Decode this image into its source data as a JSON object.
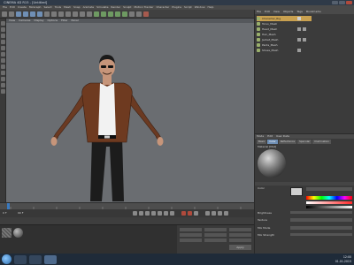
{
  "window": {
    "title": "CINEMA 4D R15 - [Untitled]"
  },
  "menubar": {
    "items": [
      "File",
      "Edit",
      "Create",
      "MoGraph",
      "Select",
      "Tools",
      "Mesh",
      "Snap",
      "Animate",
      "Simulate",
      "Render",
      "Sculpt",
      "Motion Tracker",
      "Character",
      "Plugins",
      "Script",
      "Window",
      "Help"
    ]
  },
  "viewport": {
    "menu": [
      "View",
      "Cameras",
      "Display",
      "Options",
      "Filter",
      "Panel"
    ]
  },
  "object_manager": {
    "tabs": [
      "File",
      "Edit",
      "View",
      "Objects",
      "Tags",
      "Bookmarks"
    ],
    "objects": [
      "Character_Rig",
      "Torso_Mesh",
      "Head_Mesh",
      "Hair_Mesh",
      "Jacket_Mesh",
      "Pants_Mesh",
      "Shoes_Mesh"
    ]
  },
  "attributes": {
    "tabs": [
      "Mode",
      "Edit",
      "User Data"
    ],
    "material_tabs": [
      "Basic",
      "Color",
      "Reflectance",
      "Specular",
      "Illumination"
    ],
    "material_name": "Material [Mat]",
    "labels": [
      "Color",
      "Brightness",
      "Texture",
      "Mix Mode",
      "Mix Strength"
    ]
  },
  "timeline": {
    "frame_start": "0 F",
    "frame_end": "90 F"
  },
  "coord_bar": {
    "apply_label": "Apply"
  },
  "taskbar": {
    "time": "12:00",
    "date": "01.01.2015"
  },
  "colors": {
    "viewport_bg": "#6a6d71",
    "selection": "#c8a050",
    "taskbar": "#1f2b39"
  }
}
